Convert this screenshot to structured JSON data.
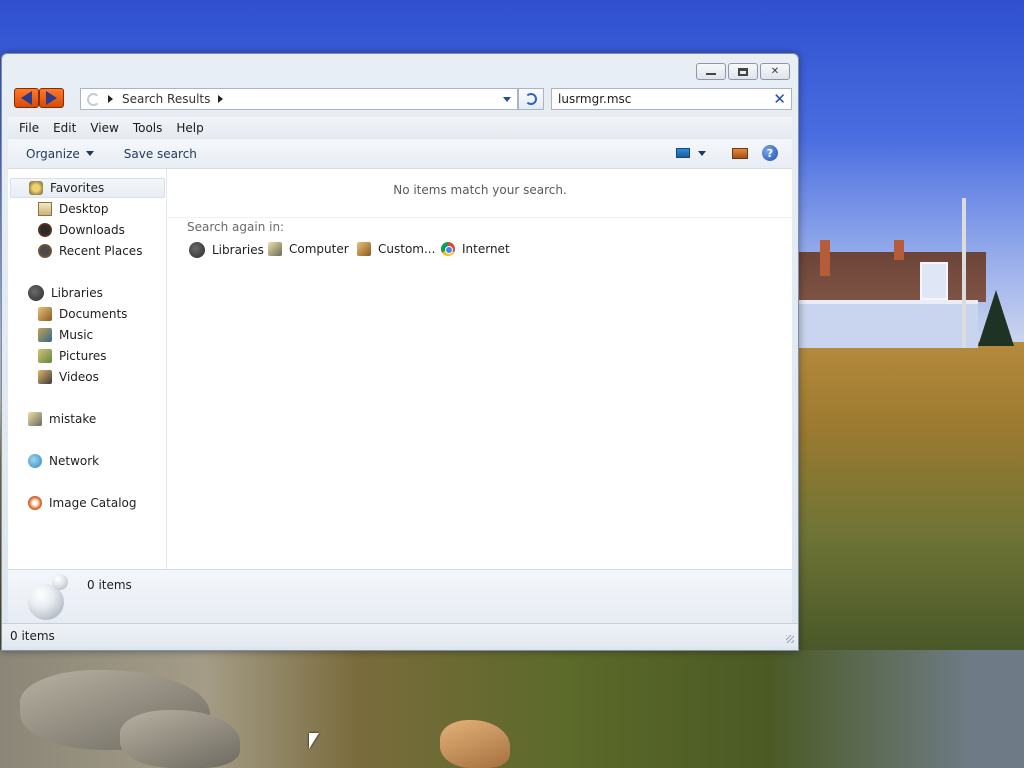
{
  "window": {
    "address": {
      "crumb": "Search Results"
    },
    "search": {
      "value": "lusrmgr.msc"
    },
    "menu": [
      "File",
      "Edit",
      "View",
      "Tools",
      "Help"
    ],
    "toolbar": {
      "organize": "Organize",
      "save_search": "Save search"
    },
    "sidebar": {
      "favorites": {
        "label": "Favorites",
        "items": [
          "Desktop",
          "Downloads",
          "Recent Places"
        ]
      },
      "libraries": {
        "label": "Libraries",
        "items": [
          "Documents",
          "Music",
          "Pictures",
          "Videos"
        ]
      },
      "computer": "mistake",
      "network": "Network",
      "catalog": "Image Catalog"
    },
    "main": {
      "empty_message": "No items match your search.",
      "search_again_label": "Search again in:",
      "locations": [
        "Libraries",
        "Computer",
        "Custom...",
        "Internet"
      ]
    },
    "details": {
      "count": "0 items"
    },
    "status": {
      "count": "0 items"
    }
  },
  "colors": {
    "accent": "#1a4bb4",
    "nav_arrows": "#e05a12",
    "window_bg": "#e9eef5"
  },
  "icons": {
    "favorites": "star-icon",
    "desktop": "desktop-icon",
    "downloads": "downloads-icon",
    "recent": "recent-places-icon",
    "libraries": "libraries-icon",
    "computer": "computer-icon",
    "network": "network-icon",
    "catalog": "image-catalog-icon",
    "internet": "chrome-icon"
  }
}
